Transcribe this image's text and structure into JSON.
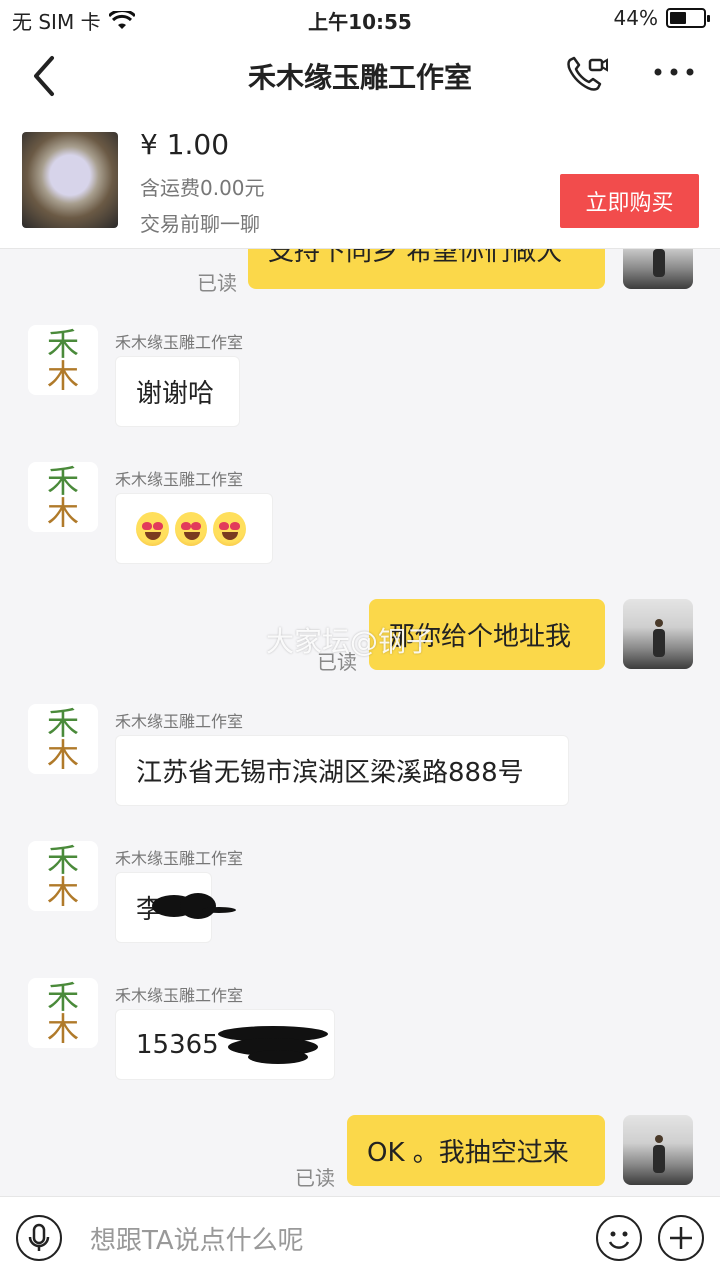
{
  "status": {
    "carrier": "无 SIM 卡",
    "time": "上午10:55",
    "battery_percent_text": "44%",
    "battery_level": 0.44
  },
  "nav": {
    "title": "禾木缘玉雕工作室"
  },
  "product": {
    "price": "¥ 1.00",
    "shipping": "含运费0.00元",
    "subtitle": "交易前聊一聊",
    "buy_label": "立即购买"
  },
  "chat": {
    "read_label": "已读",
    "shop_avatar_top": "禾",
    "shop_avatar_bottom": "木",
    "messages": [
      {
        "from": "me",
        "text": "支持下同乡 希望你们做大"
      },
      {
        "from": "shop",
        "sender": "禾木缘玉雕工作室",
        "text": "谢谢哈"
      },
      {
        "from": "shop",
        "sender": "禾木缘玉雕工作室",
        "type": "emoji",
        "count": 3
      },
      {
        "from": "me",
        "text": "那你给个地址我"
      },
      {
        "from": "shop",
        "sender": "禾木缘玉雕工作室",
        "text": "江苏省无锡市滨湖区梁溪路888号"
      },
      {
        "from": "shop",
        "sender": "禾木缘玉雕工作室",
        "text": "李"
      },
      {
        "from": "shop",
        "sender": "禾木缘玉雕工作室",
        "text": "15365"
      },
      {
        "from": "me",
        "text": "OK 。我抽空过来"
      }
    ]
  },
  "watermark": "大家坛@钢子",
  "input": {
    "placeholder": "想跟TA说点什么呢"
  },
  "colors": {
    "outgoing_bubble": "#fbd84a",
    "buy_button": "#f24c4c",
    "chat_background": "#f5f5f7"
  }
}
